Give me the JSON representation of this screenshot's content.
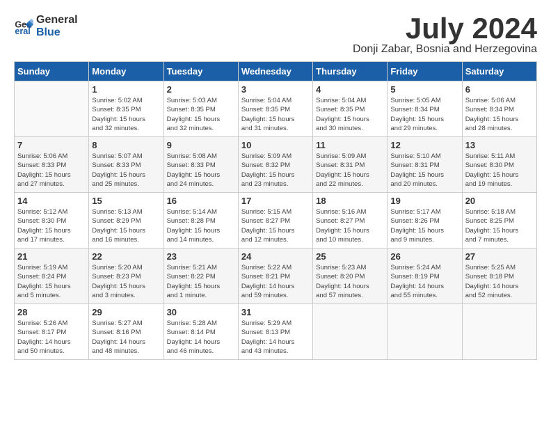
{
  "logo": {
    "line1": "General",
    "line2": "Blue"
  },
  "title": "July 2024",
  "subtitle": "Donji Zabar, Bosnia and Herzegovina",
  "days_of_week": [
    "Sunday",
    "Monday",
    "Tuesday",
    "Wednesday",
    "Thursday",
    "Friday",
    "Saturday"
  ],
  "weeks": [
    [
      {
        "day": "",
        "info": ""
      },
      {
        "day": "1",
        "info": "Sunrise: 5:02 AM\nSunset: 8:35 PM\nDaylight: 15 hours\nand 32 minutes."
      },
      {
        "day": "2",
        "info": "Sunrise: 5:03 AM\nSunset: 8:35 PM\nDaylight: 15 hours\nand 32 minutes."
      },
      {
        "day": "3",
        "info": "Sunrise: 5:04 AM\nSunset: 8:35 PM\nDaylight: 15 hours\nand 31 minutes."
      },
      {
        "day": "4",
        "info": "Sunrise: 5:04 AM\nSunset: 8:35 PM\nDaylight: 15 hours\nand 30 minutes."
      },
      {
        "day": "5",
        "info": "Sunrise: 5:05 AM\nSunset: 8:34 PM\nDaylight: 15 hours\nand 29 minutes."
      },
      {
        "day": "6",
        "info": "Sunrise: 5:06 AM\nSunset: 8:34 PM\nDaylight: 15 hours\nand 28 minutes."
      }
    ],
    [
      {
        "day": "7",
        "info": "Sunrise: 5:06 AM\nSunset: 8:33 PM\nDaylight: 15 hours\nand 27 minutes."
      },
      {
        "day": "8",
        "info": "Sunrise: 5:07 AM\nSunset: 8:33 PM\nDaylight: 15 hours\nand 25 minutes."
      },
      {
        "day": "9",
        "info": "Sunrise: 5:08 AM\nSunset: 8:33 PM\nDaylight: 15 hours\nand 24 minutes."
      },
      {
        "day": "10",
        "info": "Sunrise: 5:09 AM\nSunset: 8:32 PM\nDaylight: 15 hours\nand 23 minutes."
      },
      {
        "day": "11",
        "info": "Sunrise: 5:09 AM\nSunset: 8:31 PM\nDaylight: 15 hours\nand 22 minutes."
      },
      {
        "day": "12",
        "info": "Sunrise: 5:10 AM\nSunset: 8:31 PM\nDaylight: 15 hours\nand 20 minutes."
      },
      {
        "day": "13",
        "info": "Sunrise: 5:11 AM\nSunset: 8:30 PM\nDaylight: 15 hours\nand 19 minutes."
      }
    ],
    [
      {
        "day": "14",
        "info": "Sunrise: 5:12 AM\nSunset: 8:30 PM\nDaylight: 15 hours\nand 17 minutes."
      },
      {
        "day": "15",
        "info": "Sunrise: 5:13 AM\nSunset: 8:29 PM\nDaylight: 15 hours\nand 16 minutes."
      },
      {
        "day": "16",
        "info": "Sunrise: 5:14 AM\nSunset: 8:28 PM\nDaylight: 15 hours\nand 14 minutes."
      },
      {
        "day": "17",
        "info": "Sunrise: 5:15 AM\nSunset: 8:27 PM\nDaylight: 15 hours\nand 12 minutes."
      },
      {
        "day": "18",
        "info": "Sunrise: 5:16 AM\nSunset: 8:27 PM\nDaylight: 15 hours\nand 10 minutes."
      },
      {
        "day": "19",
        "info": "Sunrise: 5:17 AM\nSunset: 8:26 PM\nDaylight: 15 hours\nand 9 minutes."
      },
      {
        "day": "20",
        "info": "Sunrise: 5:18 AM\nSunset: 8:25 PM\nDaylight: 15 hours\nand 7 minutes."
      }
    ],
    [
      {
        "day": "21",
        "info": "Sunrise: 5:19 AM\nSunset: 8:24 PM\nDaylight: 15 hours\nand 5 minutes."
      },
      {
        "day": "22",
        "info": "Sunrise: 5:20 AM\nSunset: 8:23 PM\nDaylight: 15 hours\nand 3 minutes."
      },
      {
        "day": "23",
        "info": "Sunrise: 5:21 AM\nSunset: 8:22 PM\nDaylight: 15 hours\nand 1 minute."
      },
      {
        "day": "24",
        "info": "Sunrise: 5:22 AM\nSunset: 8:21 PM\nDaylight: 14 hours\nand 59 minutes."
      },
      {
        "day": "25",
        "info": "Sunrise: 5:23 AM\nSunset: 8:20 PM\nDaylight: 14 hours\nand 57 minutes."
      },
      {
        "day": "26",
        "info": "Sunrise: 5:24 AM\nSunset: 8:19 PM\nDaylight: 14 hours\nand 55 minutes."
      },
      {
        "day": "27",
        "info": "Sunrise: 5:25 AM\nSunset: 8:18 PM\nDaylight: 14 hours\nand 52 minutes."
      }
    ],
    [
      {
        "day": "28",
        "info": "Sunrise: 5:26 AM\nSunset: 8:17 PM\nDaylight: 14 hours\nand 50 minutes."
      },
      {
        "day": "29",
        "info": "Sunrise: 5:27 AM\nSunset: 8:16 PM\nDaylight: 14 hours\nand 48 minutes."
      },
      {
        "day": "30",
        "info": "Sunrise: 5:28 AM\nSunset: 8:14 PM\nDaylight: 14 hours\nand 46 minutes."
      },
      {
        "day": "31",
        "info": "Sunrise: 5:29 AM\nSunset: 8:13 PM\nDaylight: 14 hours\nand 43 minutes."
      },
      {
        "day": "",
        "info": ""
      },
      {
        "day": "",
        "info": ""
      },
      {
        "day": "",
        "info": ""
      }
    ]
  ]
}
